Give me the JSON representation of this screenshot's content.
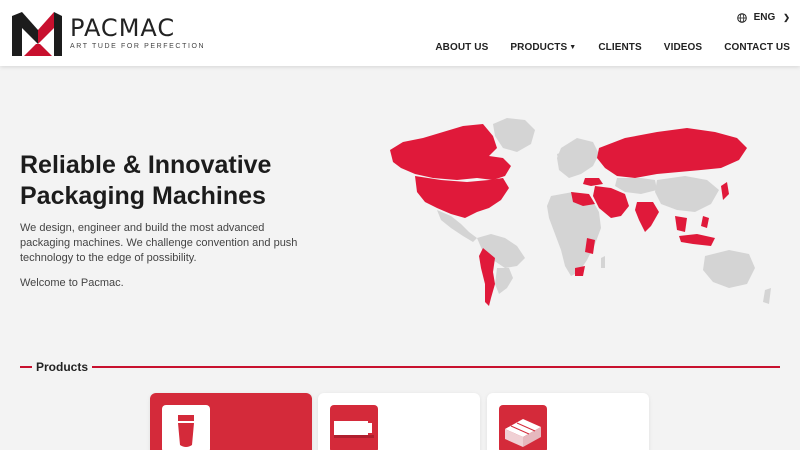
{
  "brand": {
    "name": "PACMAC",
    "tagline": "ART TUDE FOR PERFECTION"
  },
  "language": {
    "selected": "ENG"
  },
  "nav": {
    "items": [
      {
        "label": "ABOUT US"
      },
      {
        "label": "PRODUCTS"
      },
      {
        "label": "CLIENTS"
      },
      {
        "label": "VIDEOS"
      },
      {
        "label": "CONTACT US"
      }
    ]
  },
  "hero": {
    "title_line1": "Reliable & Innovative",
    "title_line2": "Packaging Machines",
    "description": "We design, engineer and build the most advanced packaging machines. We challenge convention and push technology to the edge of possibility.",
    "welcome": "Welcome to Pacmac."
  },
  "products": {
    "heading": "Products",
    "cards": [
      {
        "icon": "tube-icon",
        "active": true
      },
      {
        "icon": "machine-icon",
        "active": false
      },
      {
        "icon": "carton-icon",
        "active": false
      }
    ]
  },
  "colors": {
    "accent": "#c8102e",
    "map_highlight": "#e0193a",
    "map_base": "#d4d4d4",
    "background": "#f3f3f3"
  },
  "icons": [
    "globe-icon",
    "chevron-down-icon",
    "caret-down-icon",
    "world-map",
    "tube-icon",
    "machine-icon",
    "carton-icon"
  ]
}
